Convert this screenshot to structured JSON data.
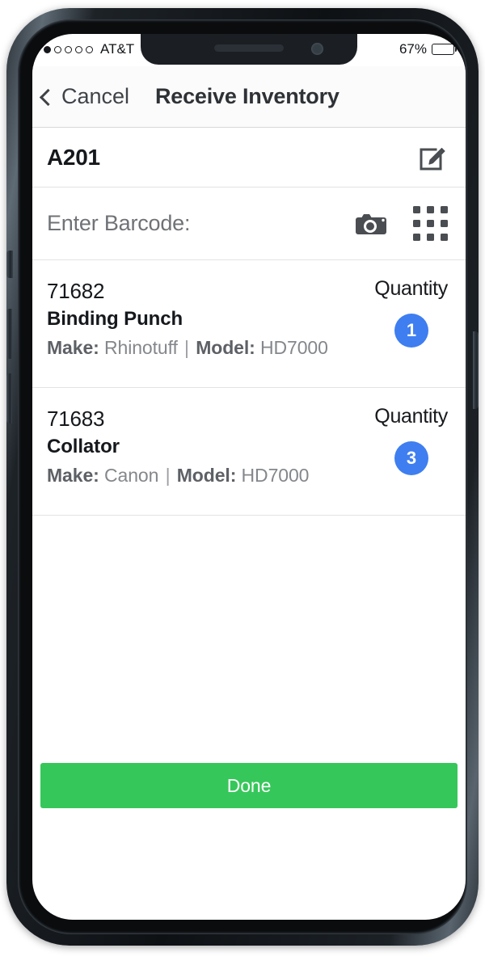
{
  "status_bar": {
    "signal_dots_total": 5,
    "signal_dots_filled": 1,
    "carrier": "AT&T",
    "battery_percent_label": "67%",
    "battery_level": 67
  },
  "nav": {
    "back_label": "Cancel",
    "title": "Receive Inventory",
    "back_icon": "chevron-left-icon"
  },
  "location_row": {
    "value": "A201",
    "edit_icon": "compose-edit-icon"
  },
  "barcode_row": {
    "label": "Enter Barcode:",
    "camera_icon": "camera-icon",
    "keypad_icon": "keypad-grid-icon"
  },
  "items": [
    {
      "sku": "71682",
      "name": "Binding Punch",
      "make_label": "Make:",
      "make_value": "Rhinotuff",
      "separator": "|",
      "model_label": "Model:",
      "model_value": "HD7000",
      "quantity_label": "Quantity",
      "quantity": "1"
    },
    {
      "sku": "71683",
      "name": "Collator",
      "make_label": "Make:",
      "make_value": "Canon",
      "separator": "|",
      "model_label": "Model:",
      "model_value": "HD7000",
      "quantity_label": "Quantity",
      "quantity": "3"
    }
  ],
  "footer": {
    "done_label": "Done"
  },
  "colors": {
    "accent_green": "#36c75a",
    "badge_blue": "#3e7ef0",
    "text_primary": "#15181c",
    "text_secondary": "#84878b",
    "separator": "#e2e3e5"
  }
}
